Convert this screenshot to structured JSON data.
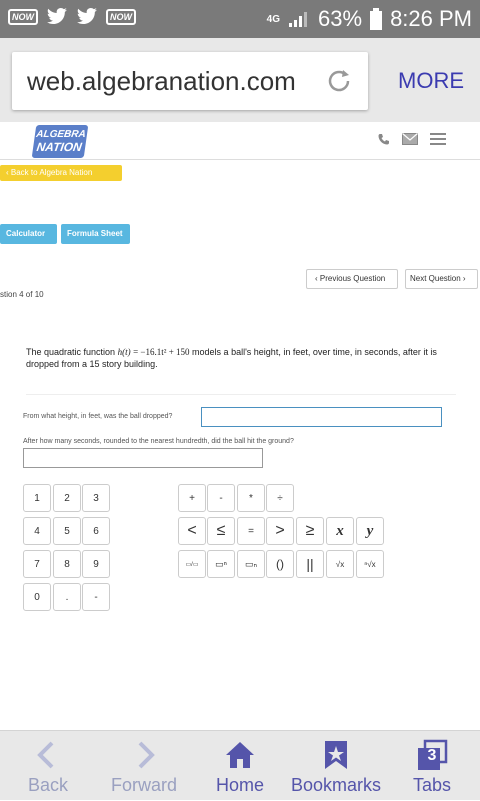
{
  "status": {
    "badge1": "NOW",
    "badge2": "NOW",
    "network": "4G",
    "battery": "63%",
    "time": "8:26 PM"
  },
  "browser": {
    "url": "web.algebranation.com",
    "more_label": "MORE"
  },
  "site": {
    "logo_line1": "ALGEBRA",
    "logo_line2": "NATION",
    "back_link": "Back to Algebra Nation",
    "calculator_label": "Calculator",
    "formula_label": "Formula Sheet",
    "prev_label": "Previous Question",
    "next_label": "Next Question",
    "question_count": "stion 4 of 10"
  },
  "question": {
    "prefix": "The quadratic function",
    "function_name": "h(t)",
    "equals": "= −16.1t² + 150",
    "suffix": "models a ball's height, in feet, over time, in seconds, after it is dropped from a 15 story building.",
    "part1": "From what height, in feet, was the ball dropped?",
    "part2": "After how many seconds, rounded to the nearest hundredth, did the ball hit the ground?"
  },
  "keypad": {
    "digits": [
      "1",
      "2",
      "3",
      "4",
      "5",
      "6",
      "7",
      "8",
      "9",
      "0",
      ".",
      "-"
    ],
    "ops1": [
      "+",
      "-",
      "*",
      "÷"
    ],
    "ops2": [
      "<",
      "≤",
      "=",
      ">",
      "≥",
      "x",
      "y"
    ],
    "ops3": [
      "▭/▭",
      "▭ⁿ",
      "▭ₙ",
      "()",
      "||",
      "√x",
      "ⁿ√x"
    ]
  },
  "tabs": {
    "back": "Back",
    "forward": "Forward",
    "home": "Home",
    "bookmarks": "Bookmarks",
    "tabs": "Tabs",
    "tabs_count": "3"
  },
  "colors": {
    "accent": "#5555aa",
    "disabled": "#9aa0c0",
    "yellow": "#f4cf2e",
    "blue": "#58b7e0"
  }
}
